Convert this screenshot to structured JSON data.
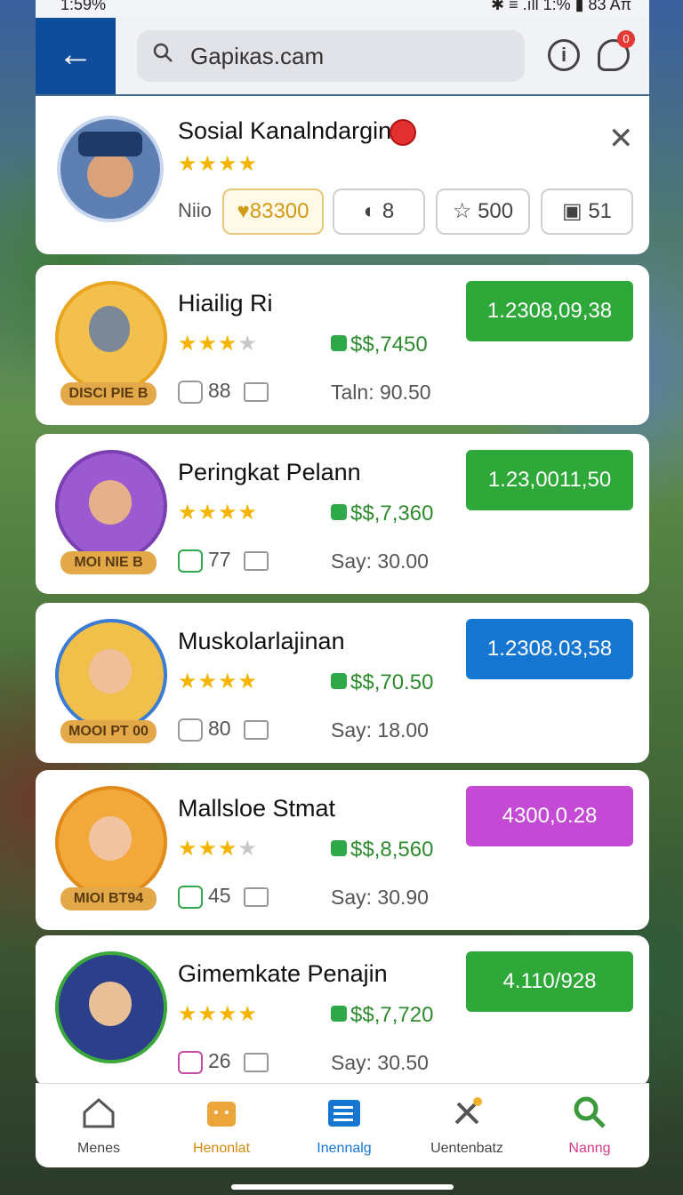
{
  "status": {
    "left": "1:59%",
    "right": "✱ ≡ .ıll 1:% ▮ 83 Aπ"
  },
  "search": {
    "text": "Gapiкas.cam"
  },
  "notifications": {
    "count": "0"
  },
  "profile": {
    "name": "Sosial Kanalndargin",
    "label": "Niio",
    "stats": [
      "83300",
      "8",
      "500",
      "51"
    ]
  },
  "cards": [
    {
      "name": "Hiailig Ri",
      "tag": "DISCI PIE B",
      "money": "$$,7450",
      "count": "88",
      "sub": "Taln: 90.50",
      "action": "1.2308,09,38",
      "action_color": "#2fa83a"
    },
    {
      "name": "Peringkat Pelann",
      "tag": "MOI NIE B",
      "money": "$$,7,360",
      "count": "77",
      "sub": "Say: 30.00",
      "action": "1.23,0011,50",
      "action_color": "#2fa83a"
    },
    {
      "name": "Muskolarlajinan",
      "tag": "MOOI PT 00",
      "money": "$$,70.50",
      "count": "80",
      "sub": "Say: 18.00",
      "action": "1.2308.03,58",
      "action_color": "#1677d2"
    },
    {
      "name": "Mallsloe Stmat",
      "tag": "MIOI BT94",
      "money": "$$,8,560",
      "count": "45",
      "sub": "Say: 30.90",
      "action": "4300,0.28",
      "action_color": "#c44ad6"
    },
    {
      "name": "Gimemkate Penajin",
      "tag": "",
      "money": "$$,7,720",
      "count": "26",
      "sub": "Say: 30.50",
      "action": "4.110/928",
      "action_color": "#2fa83a"
    }
  ],
  "nav": [
    {
      "label": "Menes",
      "color": "#444"
    },
    {
      "label": "Henonlat",
      "color": "#d08a12"
    },
    {
      "label": "Inennalg",
      "color": "#1677d2"
    },
    {
      "label": "Uentenbatz",
      "color": "#444"
    },
    {
      "label": "Nanng",
      "color": "#d63a8a"
    }
  ]
}
